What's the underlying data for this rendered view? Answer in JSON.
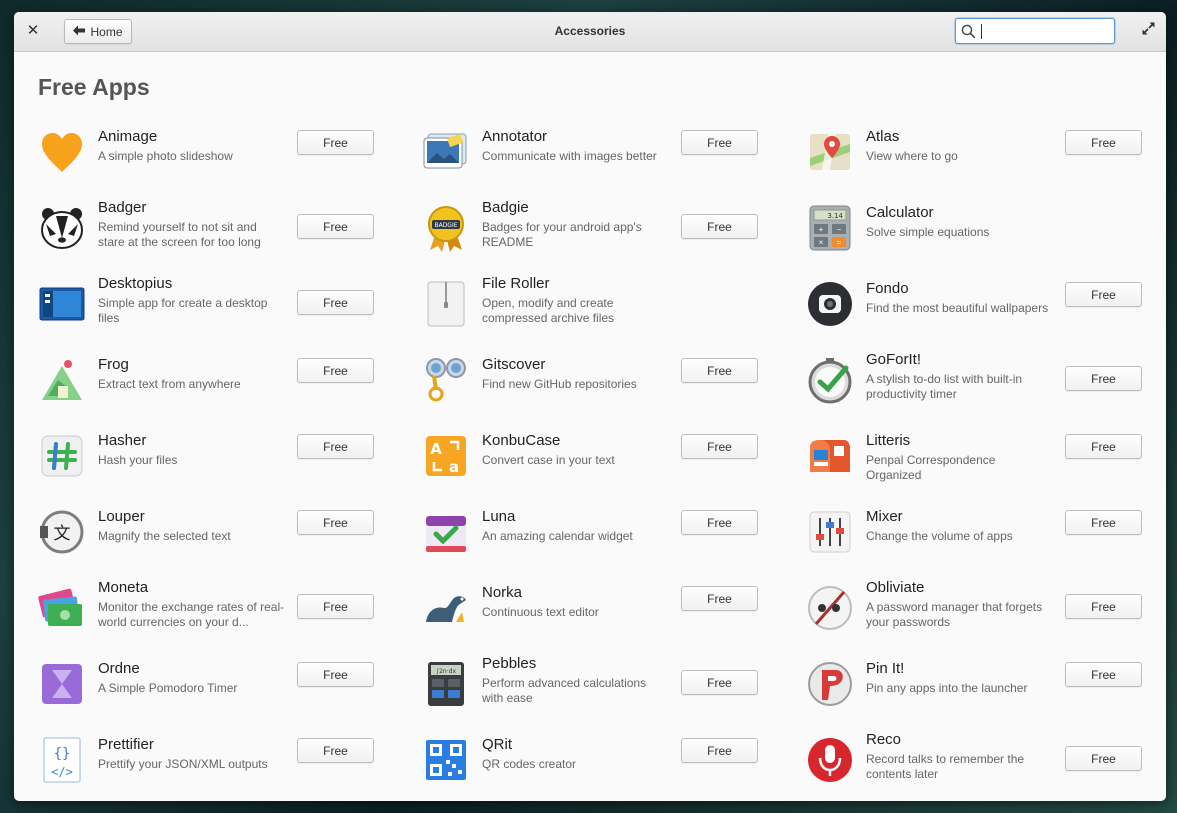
{
  "window": {
    "title": "Accessories"
  },
  "toolbar": {
    "close_label": "✕",
    "home_label": "Home"
  },
  "search": {
    "value": "",
    "placeholder": ""
  },
  "section": {
    "heading": "Free Apps"
  },
  "apps": [
    {
      "name": "Animage",
      "desc": "A simple photo slideshow",
      "price": "Free",
      "icon": "heart-icon"
    },
    {
      "name": "Annotator",
      "desc": "Communicate with images better",
      "price": "Free",
      "icon": "annotator-icon"
    },
    {
      "name": "Atlas",
      "desc": "View where to go",
      "price": "Free",
      "icon": "map-pin-icon"
    },
    {
      "name": "Badger",
      "desc": "Remind yourself to not sit and stare at the screen for too long",
      "price": "Free",
      "icon": "badger-icon"
    },
    {
      "name": "Badgie",
      "desc": "Badges for your android app's README",
      "price": "Free",
      "icon": "badge-ribbon-icon"
    },
    {
      "name": "Calculator",
      "desc": "Solve simple equations",
      "price": "",
      "icon": "calculator-icon"
    },
    {
      "name": "Desktopius",
      "desc": "Simple app for create a desktop files",
      "price": "Free",
      "icon": "desktop-icon"
    },
    {
      "name": "File Roller",
      "desc": "Open, modify and create compressed archive files",
      "price": "",
      "icon": "archive-icon"
    },
    {
      "name": "Fondo",
      "desc": "Find the most beautiful wallpapers",
      "price": "Free",
      "icon": "camera-icon"
    },
    {
      "name": "Frog",
      "desc": "Extract text from anywhere",
      "price": "Free",
      "icon": "frog-icon"
    },
    {
      "name": "Gitscover",
      "desc": "Find new GitHub repositories",
      "price": "Free",
      "icon": "binoculars-icon"
    },
    {
      "name": "GoForIt!",
      "desc": "A stylish to-do list with built-in productivity timer",
      "price": "Free",
      "icon": "clock-check-icon"
    },
    {
      "name": "Hasher",
      "desc": "Hash your files",
      "price": "Free",
      "icon": "hash-icon"
    },
    {
      "name": "KonbuCase",
      "desc": "Convert case in your text",
      "price": "Free",
      "icon": "case-convert-icon"
    },
    {
      "name": "Litteris",
      "desc": "Penpal Correspondence Organized",
      "price": "Free",
      "icon": "mailbox-icon"
    },
    {
      "name": "Louper",
      "desc": "Magnify the selected text",
      "price": "Free",
      "icon": "magnifier-text-icon"
    },
    {
      "name": "Luna",
      "desc": "An amazing calendar widget",
      "price": "Free",
      "icon": "calendar-check-icon"
    },
    {
      "name": "Mixer",
      "desc": "Change the volume of apps",
      "price": "Free",
      "icon": "mixer-sliders-icon"
    },
    {
      "name": "Moneta",
      "desc": "Monitor the exchange rates of real-world currencies on your d...",
      "price": "Free",
      "icon": "banknotes-icon"
    },
    {
      "name": "Norka",
      "desc": "Continuous text editor",
      "price": "Free",
      "icon": "otter-icon"
    },
    {
      "name": "Obliviate",
      "desc": "A password manager that forgets your passwords",
      "price": "Free",
      "icon": "wand-icon"
    },
    {
      "name": "Ordne",
      "desc": "A Simple Pomodoro Timer",
      "price": "Free",
      "icon": "hourglass-icon"
    },
    {
      "name": "Pebbles",
      "desc": "Perform advanced calculations with ease",
      "price": "Free",
      "icon": "scientific-calculator-icon"
    },
    {
      "name": "Pin It!",
      "desc": "Pin any apps into the launcher",
      "price": "Free",
      "icon": "pin-icon"
    },
    {
      "name": "Prettifier",
      "desc": "Prettify your JSON/XML outputs",
      "price": "Free",
      "icon": "code-brackets-icon"
    },
    {
      "name": "QRit",
      "desc": "QR codes creator",
      "price": "Free",
      "icon": "qr-code-icon"
    },
    {
      "name": "Reco",
      "desc": "Record talks to remember the contents later",
      "price": "Free",
      "icon": "microphone-icon"
    }
  ]
}
